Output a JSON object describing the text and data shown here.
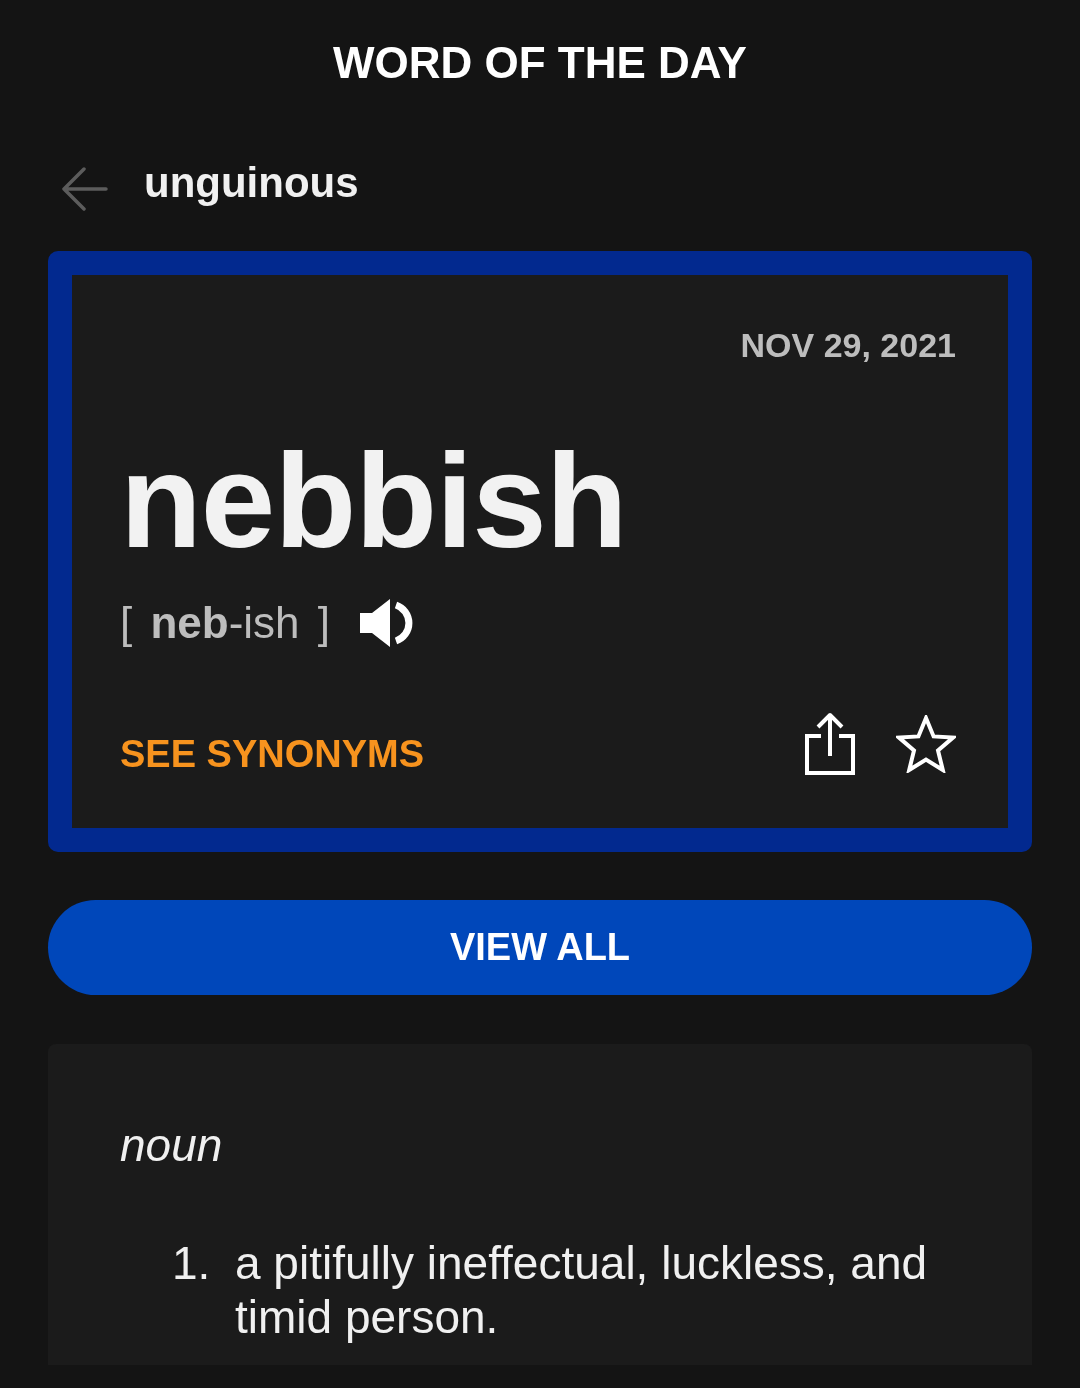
{
  "header": {
    "title": "WORD OF THE DAY"
  },
  "nav": {
    "title": "unguinous"
  },
  "word_card": {
    "date": "NOV 29, 2021",
    "word": "nebbish",
    "pronunciation": "[ **neb**-ish ]",
    "synonyms_link": "SEE SYNONYMS",
    "starred": false
  },
  "view_all_button": "VIEW ALL",
  "definitions": {
    "part_of_speech": "noun",
    "senses": [
      {
        "number": "1.",
        "text": "a pitifully ineffectual, luckless, and timid person."
      }
    ]
  }
}
